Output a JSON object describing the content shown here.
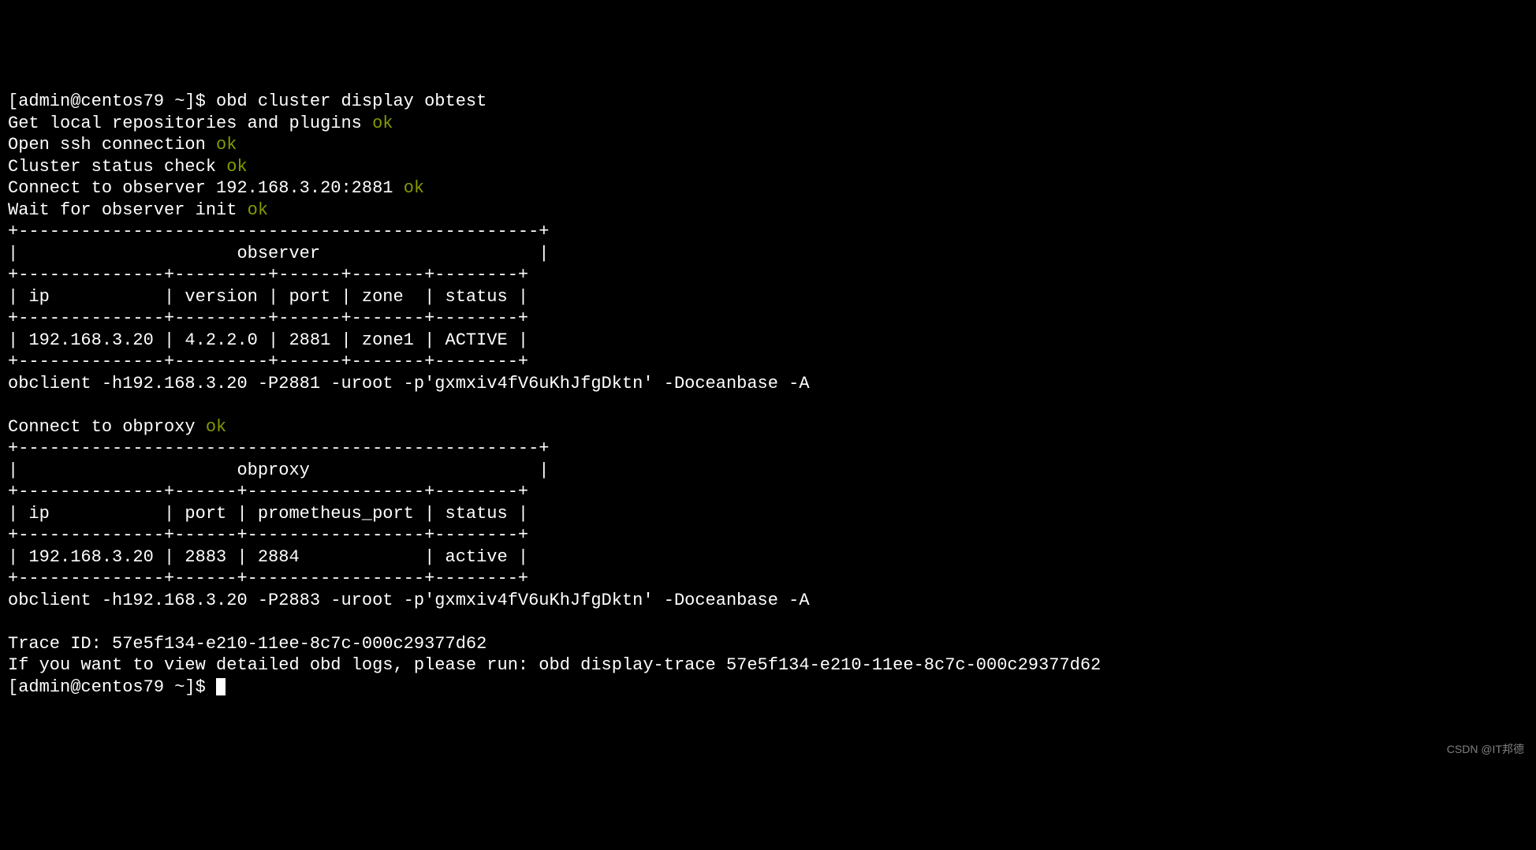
{
  "prompt1": "[admin@centos79 ~]$ ",
  "command1": "obd cluster display obtest",
  "line1": "Get local repositories and plugins ",
  "line1_ok": "ok",
  "line2": "Open ssh connection ",
  "line2_ok": "ok",
  "line3": "Cluster status check ",
  "line3_ok": "ok",
  "line4": "Connect to observer 192.168.3.20:2881 ",
  "line4_ok": "ok",
  "line5": "Wait for observer init ",
  "line5_ok": "ok",
  "observer_table": {
    "border_top": "+--------------------------------------------------+",
    "title_row": "|                     observer                     |",
    "border_mid": "+--------------+---------+------+-------+--------+",
    "header_row": "| ip           | version | port | zone  | status |",
    "data_row": "| 192.168.3.20 | 4.2.2.0 | 2881 | zone1 | ACTIVE |"
  },
  "obclient1": "obclient -h192.168.3.20 -P2881 -uroot -p'gxmxiv4fV6uKhJfgDktn' -Doceanbase -A",
  "line6": "Connect to obproxy ",
  "line6_ok": "ok",
  "obproxy_table": {
    "border_top": "+--------------------------------------------------+",
    "title_row": "|                     obproxy                      |",
    "border_mid": "+--------------+------+-----------------+--------+",
    "header_row": "| ip           | port | prometheus_port | status |",
    "data_row": "| 192.168.3.20 | 2883 | 2884            | active |"
  },
  "obclient2": "obclient -h192.168.3.20 -P2883 -uroot -p'gxmxiv4fV6uKhJfgDktn' -Doceanbase -A",
  "trace_line": "Trace ID: 57e5f134-e210-11ee-8c7c-000c29377d62",
  "detail_line": "If you want to view detailed obd logs, please run: obd display-trace 57e5f134-e210-11ee-8c7c-000c29377d62",
  "prompt2": "[admin@centos79 ~]$ ",
  "watermark": "CSDN @IT邦德"
}
